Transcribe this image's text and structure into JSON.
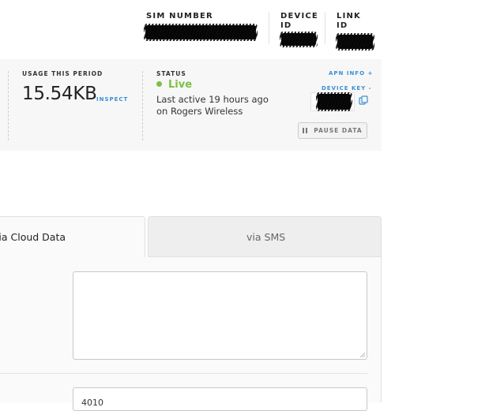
{
  "header": {
    "sim_number_label": "SIM NUMBER",
    "device_id_label": "DEVICE ID",
    "link_id_label": "LINK ID"
  },
  "usage": {
    "label": "USAGE THIS PERIOD",
    "value": "15.54KB",
    "inspect_link": "INSPECT"
  },
  "status": {
    "label": "STATUS",
    "state": "Live",
    "last_active": "Last active 19 hours ago",
    "carrier": "on Rogers Wireless",
    "live_color": "#7bc142"
  },
  "actions": {
    "apn_info": "APN INFO +",
    "device_key": "DEVICE KEY -",
    "pause_button": "PAUSE DATA"
  },
  "tabs": [
    {
      "label": "via Cloud Data",
      "active": true
    },
    {
      "label": "via SMS",
      "active": false
    }
  ],
  "form": {
    "message_value": "",
    "port_value": "4010"
  },
  "colors": {
    "link_blue": "#3a8fd6",
    "panel_bg": "#f7f7f7"
  }
}
